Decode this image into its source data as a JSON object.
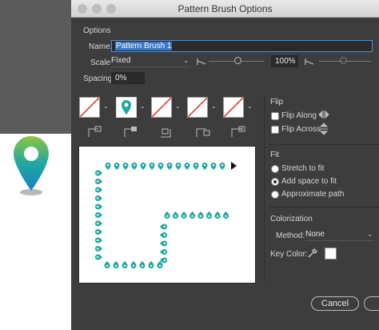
{
  "dialog": {
    "title": "Pattern Brush Options",
    "options_heading": "Options",
    "name_label": "Name:",
    "name_value": "Pattern Brush 1",
    "scale_label": "Scale:",
    "scale_value": "Fixed",
    "scale_percent": "100%",
    "spacing_label": "Spacing:",
    "spacing_value": "0%",
    "flip": {
      "heading": "Flip",
      "along_label": "Flip Along",
      "across_label": "Flip Across",
      "along_checked": false,
      "across_checked": false
    },
    "fit": {
      "heading": "Fit",
      "options": [
        "Stretch to fit",
        "Add space to fit",
        "Approximate path"
      ],
      "selected": "Add space to fit"
    },
    "colorization": {
      "heading": "Colorization",
      "method_label": "Method:",
      "method_value": "None",
      "key_color_label": "Key Color:",
      "key_color": "#ffffff"
    },
    "cancel_label": "Cancel"
  },
  "colors": {
    "accent": "#3b76c4",
    "pin_top": "#8bc53f",
    "pin_mid": "#1fa9a0",
    "pin_bottom": "#1b7fc4",
    "tile_slash": "#d62b2b"
  }
}
